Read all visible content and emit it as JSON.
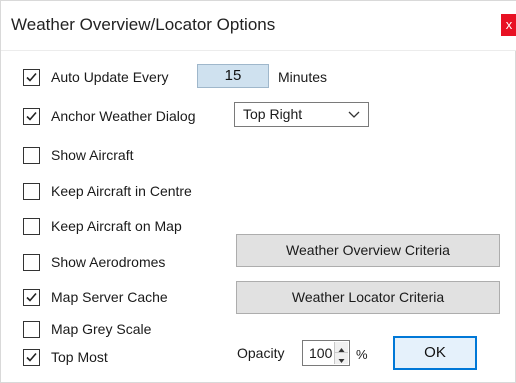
{
  "window": {
    "title": "Weather Overview/Locator Options",
    "close_label": "x"
  },
  "options": {
    "auto_update": {
      "label": "Auto Update Every",
      "checked": true,
      "minutes_value": "15",
      "minutes_label": "Minutes"
    },
    "anchor": {
      "label": "Anchor Weather Dialog",
      "checked": true,
      "position_value": "Top Right"
    },
    "show_aircraft": {
      "label": "Show Aircraft",
      "checked": false
    },
    "keep_centre": {
      "label": "Keep Aircraft in Centre",
      "checked": false
    },
    "keep_on_map": {
      "label": "Keep Aircraft on Map",
      "checked": false
    },
    "show_aerodromes": {
      "label": "Show Aerodromes",
      "checked": false
    },
    "map_cache": {
      "label": "Map Server Cache",
      "checked": true
    },
    "map_grey": {
      "label": "Map Grey Scale",
      "checked": false
    },
    "top_most": {
      "label": "Top Most",
      "checked": true
    }
  },
  "buttons": {
    "overview_criteria": "Weather Overview Criteria",
    "locator_criteria": "Weather Locator Criteria",
    "ok": "OK"
  },
  "opacity": {
    "label": "Opacity",
    "value": "100",
    "unit": "%"
  }
}
